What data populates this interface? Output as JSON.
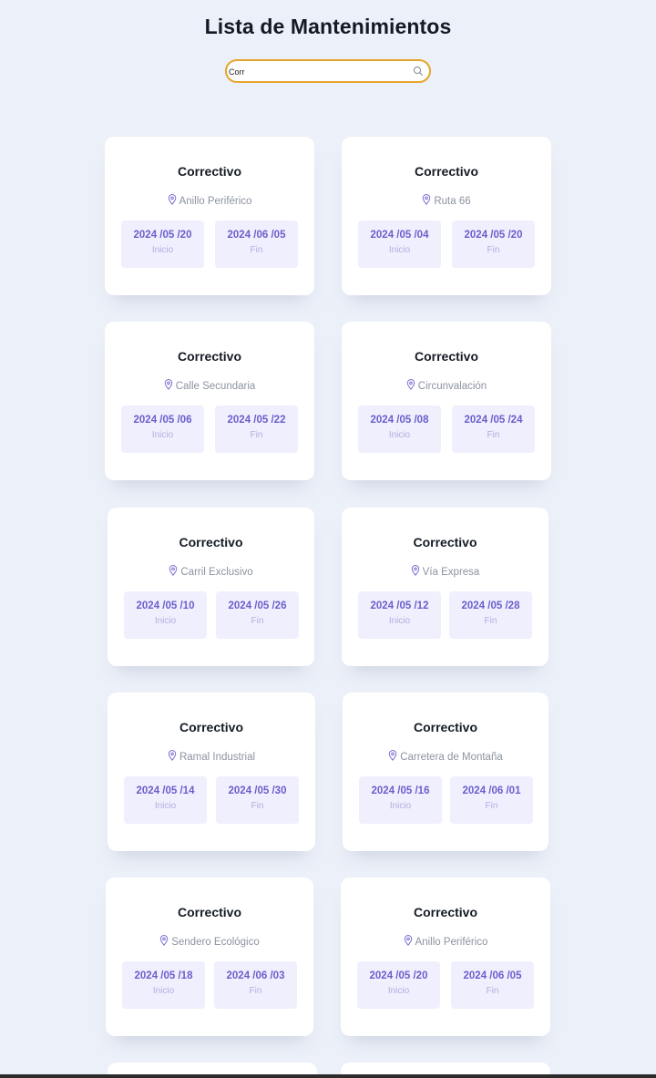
{
  "header": {
    "title": "Lista de Mantenimientos"
  },
  "search": {
    "value": "Corr"
  },
  "labels": {
    "start": "Inicio",
    "end": "Fin"
  },
  "cards": [
    {
      "type": "Correctivo",
      "location": "Anillo Periférico",
      "start": "2024 /05 /20",
      "end": "2024 /06 /05"
    },
    {
      "type": "Correctivo",
      "location": "Ruta 66",
      "start": "2024 /05 /04",
      "end": "2024 /05 /20"
    },
    {
      "type": "Correctivo",
      "location": "Calle Secundaria",
      "start": "2024 /05 /06",
      "end": "2024 /05 /22"
    },
    {
      "type": "Correctivo",
      "location": "Circunvalación",
      "start": "2024 /05 /08",
      "end": "2024 /05 /24"
    },
    {
      "type": "Correctivo",
      "location": "Carril Exclusivo",
      "start": "2024 /05 /10",
      "end": "2024 /05 /26"
    },
    {
      "type": "Correctivo",
      "location": "Vía Expresa",
      "start": "2024 /05 /12",
      "end": "2024 /05 /28"
    },
    {
      "type": "Correctivo",
      "location": "Ramal Industrial",
      "start": "2024 /05 /14",
      "end": "2024 /05 /30"
    },
    {
      "type": "Correctivo",
      "location": "Carretera de Montaña",
      "start": "2024 /05 /16",
      "end": "2024 /06 /01"
    },
    {
      "type": "Correctivo",
      "location": "Sendero Ecológico",
      "start": "2024 /05 /18",
      "end": "2024 /06 /03"
    },
    {
      "type": "Correctivo",
      "location": "Anillo Periférico",
      "start": "2024 /05 /20",
      "end": "2024 /06 /05"
    }
  ]
}
